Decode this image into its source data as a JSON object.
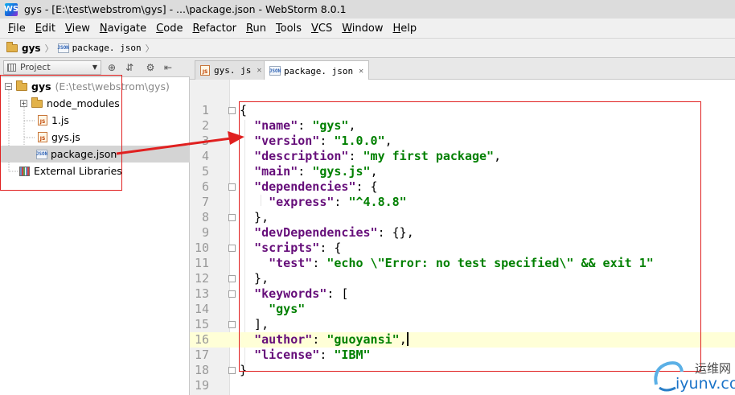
{
  "window": {
    "title": "gys - [E:\\test\\webstrom\\gys] - ...\\package.json - WebStorm 8.0.1",
    "app_icon": "WS"
  },
  "menu": [
    "File",
    "Edit",
    "View",
    "Navigate",
    "Code",
    "Refactor",
    "Run",
    "Tools",
    "VCS",
    "Window",
    "Help"
  ],
  "breadcrumb": {
    "project": "gys",
    "file": "package. json"
  },
  "project_panel": {
    "view_label": "Project",
    "tree": {
      "root_name": "gys",
      "root_path": "(E:\\test\\webstrom\\gys)",
      "items": [
        "node_modules",
        "1.js",
        "gys.js",
        "package.json"
      ],
      "external": "External Libraries"
    }
  },
  "tabs": [
    {
      "label": "gys. js",
      "active": false
    },
    {
      "label": "package. json",
      "active": true
    }
  ],
  "editor": {
    "current_line": 16,
    "line_numbers": [
      "1",
      "2",
      "3",
      "4",
      "5",
      "6",
      "7",
      "8",
      "9",
      "10",
      "11",
      "12",
      "13",
      "14",
      "15",
      "16",
      "17",
      "18",
      "19"
    ],
    "code": {
      "l1": "{",
      "l2_key": "\"name\"",
      "l2_val": "\"gys\"",
      "l3_key": "\"version\"",
      "l3_val": "\"1.0.0\"",
      "l4_key": "\"description\"",
      "l4_val": "\"my first package\"",
      "l5_key": "\"main\"",
      "l5_val": "\"gys.js\"",
      "l6_key": "\"dependencies\"",
      "l7_key": "\"express\"",
      "l7_val": "\"^4.8.8\"",
      "l9_key": "\"devDependencies\"",
      "l10_key": "\"scripts\"",
      "l11_key": "\"test\"",
      "l11_val": "\"echo \\\"Error: no test specified\\\" && exit 1\"",
      "l13_key": "\"keywords\"",
      "l14_val": "\"gys\"",
      "l16_key": "\"author\"",
      "l16_val": "\"guoyansi\"",
      "l17_key": "\"license\"",
      "l17_val": "\"IBM\"",
      "l18": "}"
    }
  },
  "watermark": {
    "cn": "运维网",
    "en": "iyunv.com"
  },
  "colors": {
    "key": "#660e7a",
    "string": "#008000",
    "annotation": "#e02020",
    "current_line": "#ffffd7"
  }
}
